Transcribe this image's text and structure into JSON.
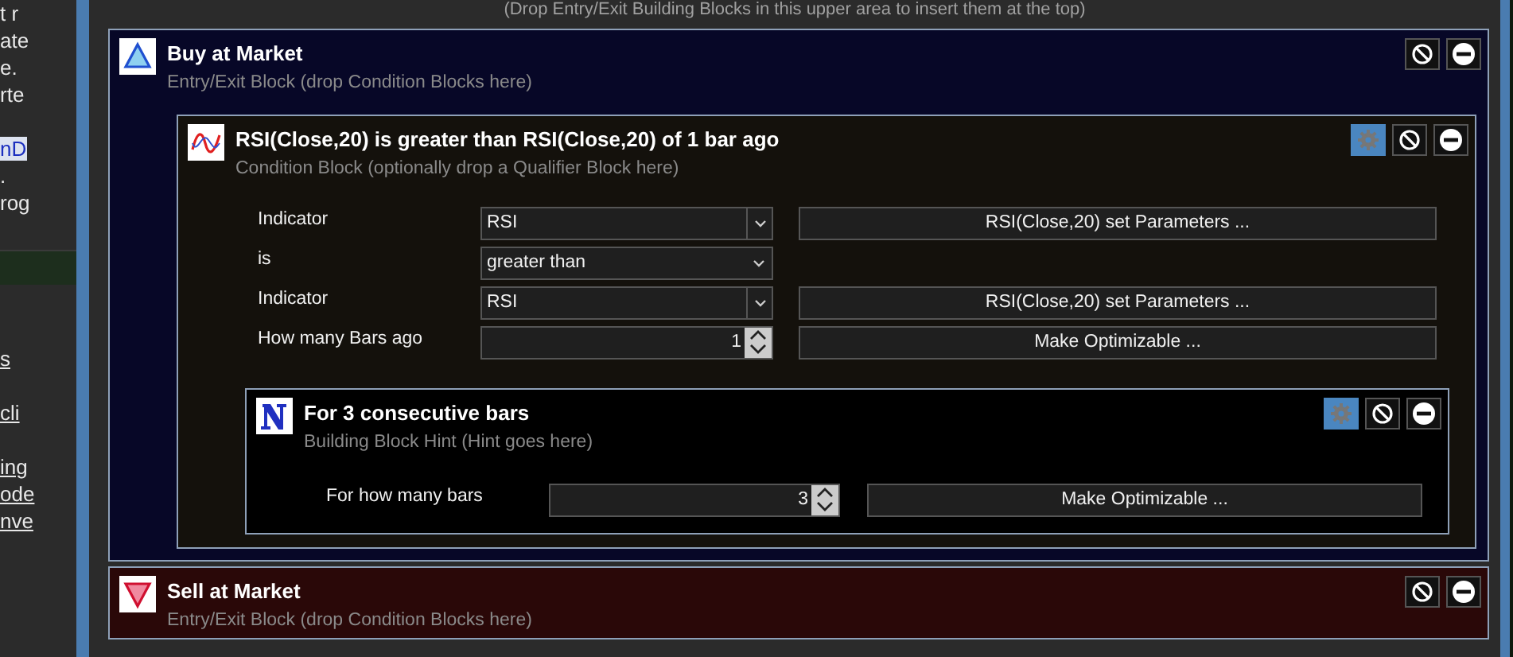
{
  "left_panel": {
    "lines": [
      {
        "kind": "text",
        "text": "t r"
      },
      {
        "kind": "text",
        "text": "ate"
      },
      {
        "kind": "text",
        "text": "e."
      },
      {
        "kind": "text",
        "text": "rte"
      },
      {
        "kind": "gap"
      },
      {
        "kind": "highlight",
        "text": "nD"
      },
      {
        "kind": "text",
        "text": "."
      },
      {
        "kind": "text",
        "text": "rog"
      },
      {
        "kind": "gap"
      },
      {
        "kind": "bar"
      },
      {
        "kind": "gap"
      },
      {
        "kind": "gap"
      },
      {
        "kind": "link",
        "text": "s"
      },
      {
        "kind": "gap"
      },
      {
        "kind": "link",
        "text": "cli"
      },
      {
        "kind": "gap"
      },
      {
        "kind": "link",
        "text": "ing"
      },
      {
        "kind": "link",
        "text": "ode"
      },
      {
        "kind": "link",
        "text": "nve"
      }
    ]
  },
  "drop_hint": "(Drop Entry/Exit Building Blocks in this upper area to insert them at the top)",
  "blocks": [
    {
      "kind": "buy",
      "title": "Buy at Market",
      "hint": "Entry/Exit Block (drop Condition Blocks here)",
      "actions": [
        {
          "kind": "disable"
        },
        {
          "kind": "remove"
        }
      ],
      "children": [
        {
          "kind": "condition",
          "title": "RSI(Close,20) is greater than RSI(Close,20) of 1 bar ago",
          "hint": "Condition Block (optionally drop a Qualifier Block here)",
          "actions": [
            {
              "kind": "settings",
              "on": true
            },
            {
              "kind": "disable"
            },
            {
              "kind": "remove"
            }
          ],
          "params": [
            {
              "label": "Indicator",
              "control": {
                "kind": "combo",
                "value": "RSI"
              },
              "button": "RSI(Close,20) set Parameters ..."
            },
            {
              "label": "is",
              "control": {
                "kind": "dropdown",
                "value": "greater than"
              }
            },
            {
              "label": "Indicator",
              "control": {
                "kind": "combo",
                "value": "RSI"
              },
              "button": "RSI(Close,20) set Parameters ..."
            },
            {
              "label": "How many Bars ago",
              "control": {
                "kind": "spin",
                "value": "1"
              },
              "button": "Make Optimizable ..."
            }
          ],
          "children": [
            {
              "kind": "qualifier",
              "title": "For 3 consecutive bars",
              "hint": "Building Block Hint (Hint goes here)",
              "actions": [
                {
                  "kind": "settings",
                  "on": true
                },
                {
                  "kind": "disable"
                },
                {
                  "kind": "remove"
                }
              ],
              "params": [
                {
                  "label": "For how many bars",
                  "control": {
                    "kind": "spin",
                    "value": "3"
                  },
                  "button": "Make Optimizable ..."
                }
              ]
            }
          ]
        }
      ]
    },
    {
      "kind": "sell",
      "title": "Sell at Market",
      "hint": "Entry/Exit Block (drop Condition Blocks here)",
      "actions": [
        {
          "kind": "disable"
        },
        {
          "kind": "remove"
        }
      ]
    }
  ]
}
